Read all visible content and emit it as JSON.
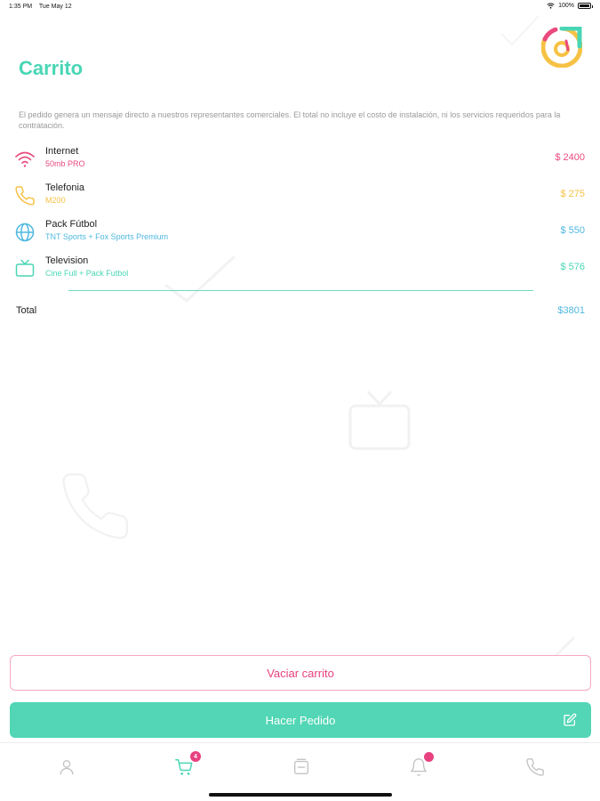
{
  "status_bar": {
    "time": "1:35 PM",
    "date": "Tue May 12",
    "battery_label": "100%",
    "battery_level": 1.0
  },
  "header": {
    "title": "Carrito"
  },
  "description": "El pedido genera un mensaje directo a nuestros representantes comerciales. El total no incluye el costo de instalación, ni los servicios requeridos para la contratación.",
  "items": [
    {
      "icon": "wifi-icon",
      "name": "Internet",
      "detail": "50mb PRO",
      "price": "$ 2400",
      "color": "#ea4a7d"
    },
    {
      "icon": "phone-icon",
      "name": "Telefonia",
      "detail": "M200",
      "price": "$ 275",
      "color": "#f6c245"
    },
    {
      "icon": "globe-icon",
      "name": "Pack Fútbol",
      "detail": "TNT Sports + Fox Sports Premium",
      "price": "$ 550",
      "color": "#4fb8df"
    },
    {
      "icon": "tv-icon",
      "name": "Television",
      "detail": "Cine Full + Pack Futbol",
      "price": "$ 576",
      "color": "#49d6b5"
    }
  ],
  "total": {
    "label": "Total",
    "value": "$3801"
  },
  "buttons": {
    "empty_cart": "Vaciar carrito",
    "place_order": "Hacer Pedido"
  },
  "tab_bar": {
    "tabs": [
      {
        "name": "profile-tab",
        "icon": "user-icon"
      },
      {
        "name": "cart-tab",
        "icon": "cart-icon",
        "badge": "4",
        "active": true
      },
      {
        "name": "catalog-tab",
        "icon": "catalog-icon"
      },
      {
        "name": "notifications-tab",
        "icon": "bell-icon"
      },
      {
        "name": "contact-tab",
        "icon": "phone-icon"
      }
    ]
  },
  "colors": {
    "accent": "#49d6b5",
    "pink": "#e8417f",
    "yellow": "#f6c245",
    "blue": "#4fb8df"
  }
}
